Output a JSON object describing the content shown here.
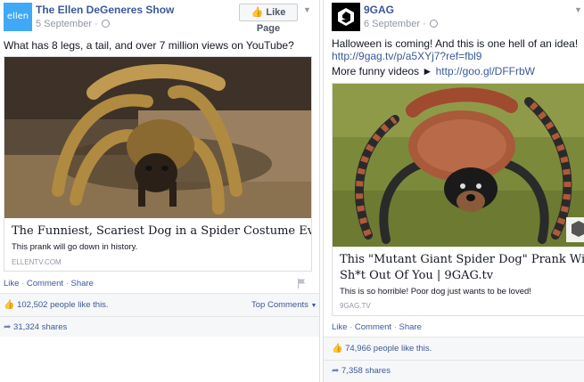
{
  "left_post": {
    "page_name": "The Ellen DeGeneres Show",
    "avatar_text": "ellen",
    "date": "5 September",
    "like_button": "Like Page",
    "message": "What has 8 legs, a tail, and over 7 million views on YouTube?",
    "card": {
      "title": "The Funniest, Scariest Dog in a Spider Costume Ever",
      "description": "This prank will go down in history.",
      "domain": "ELLENTV.COM"
    },
    "actions": {
      "like": "Like",
      "comment": "Comment",
      "share": "Share"
    },
    "likes": {
      "count": "102,502 people",
      "suffix": "like this."
    },
    "top_comments": "Top Comments",
    "shares": "31,324 shares"
  },
  "right_post": {
    "page_name": "9GAG",
    "date": "6 September",
    "message_line1": "Halloween is coming! And this is one hell of an idea!",
    "message_link1": "http://9gag.tv/p/a5XYj7?ref=fbl9",
    "message_line3_prefix": "More funny videos ►",
    "message_link2": "http://goo.gl/DFFrbW",
    "card": {
      "title_line1": "This \"Mutant Giant Spider Dog\" Prank Will Sc",
      "title_line2": "Sh*t Out Of You | 9GAG.tv",
      "description": "This is so horrible! Poor dog just wants to be loved!",
      "domain": "9GAG.TV"
    },
    "actions": {
      "like": "Like",
      "comment": "Comment",
      "share": "Share"
    },
    "likes": {
      "count": "74,966 people",
      "suffix": "like this."
    },
    "shares": "7,358 shares"
  },
  "colors": {
    "facebook_blue": "#3b5998",
    "link_blue": "#6d84b4",
    "grey_text": "#9197a3",
    "ellen_blue": "#3fa9f5"
  },
  "icons": [
    "globe-icon",
    "thumbs-up-icon",
    "share-arrow-icon",
    "flag-icon",
    "chevron-down-icon",
    "9gag-logo-icon"
  ]
}
